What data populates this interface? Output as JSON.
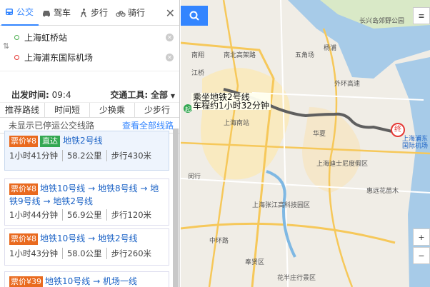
{
  "tabs": [
    {
      "label": "公交",
      "icon": "bus-icon"
    },
    {
      "label": "驾车",
      "icon": "car-icon"
    },
    {
      "label": "步行",
      "icon": "walk-icon"
    },
    {
      "label": "骑行",
      "icon": "bike-icon"
    }
  ],
  "start": "上海虹桥站",
  "end": "上海浦东国际机场",
  "depart_label": "出发时间:",
  "depart_value": "09:4",
  "tool_label": "交通工具:",
  "tool_value": "全部",
  "sort_options": [
    "推荐路线",
    "时间短",
    "少换乘",
    "少步行"
  ],
  "hidden_note": "未显示已停运公交线路",
  "view_all": "查看全部线路",
  "routes": [
    {
      "price": "票价¥8",
      "tag": "直达",
      "line": "地铁2号线",
      "time": "1小时41分钟",
      "dist": "58.2公里",
      "walk": "步行430米"
    },
    {
      "price": "票价¥8",
      "tag": "",
      "line": "地铁10号线 → 地铁8号线 → 地铁9号线 → 地铁2号线",
      "time": "1小时44分钟",
      "dist": "56.9公里",
      "walk": "步行120米"
    },
    {
      "price": "票价¥8",
      "tag": "",
      "line": "地铁10号线 → 地铁2号线",
      "time": "1小时43分钟",
      "dist": "58.0公里",
      "walk": "步行260米"
    },
    {
      "price": "票价¥39",
      "tag": "",
      "line": "地铁10号线 → 机场一线",
      "time": "",
      "dist": "",
      "walk": ""
    }
  ],
  "map_tip_line1": "乘坐地铁2号线",
  "map_tip_line2": "车程约1小时32分钟",
  "end_marker": "终",
  "map_labels": {
    "pudong_airport": "上海浦东国际机场",
    "south_station": "上海南站",
    "disney": "上海迪士尼度假区",
    "nanxiang": "南翔",
    "jiangqiao": "江桥",
    "wujiaochang": "五角场",
    "zhangjiang": "上海张江高科技园区",
    "fengxian": "奉贤区",
    "nanbei": "南北高架路",
    "waihuan": "外环高速",
    "yangpu": "杨浦",
    "minhang": "闵行",
    "changxing": "长兴岛郊野公园",
    "huaxia": "华夏",
    "zhonghuan": "中环路",
    "huadong_park": "惠远花苗木",
    "huagang": "花半庄行景区",
    "jinhui": "金惠"
  },
  "colors": {
    "accent": "#3385ff",
    "route": "#666666",
    "price": "#e96a1f",
    "direct": "#33a852",
    "link": "#1c63c6"
  }
}
